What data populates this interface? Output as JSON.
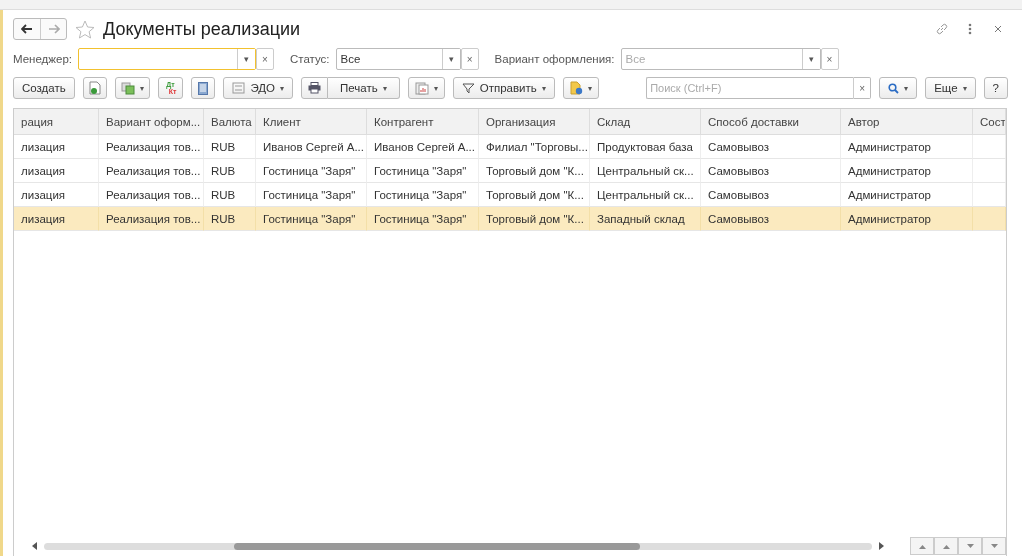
{
  "window": {
    "title": "Документы реализации",
    "favorite": false
  },
  "filters": [
    {
      "label": "Менеджер:",
      "focused": true,
      "dim": false
    },
    {
      "label": "Статус:",
      "value": "Все",
      "focused": false,
      "dim": false
    },
    {
      "label": "Вариант оформления:",
      "value": "Все",
      "focused": false,
      "dim": true
    }
  ],
  "filter_dropdown_glyph": "▾",
  "filter_clear_glyph": "×",
  "toolbar": {
    "create": "Создать",
    "dt_kt": [
      "Дт",
      "Кт"
    ],
    "edo": "ЭДО",
    "print": "Печать",
    "send": "Отправить",
    "search_placeholder": "Поиск (Ctrl+F)",
    "search_clear": "×",
    "more": "Еще",
    "help": "?",
    "caret": "▾"
  },
  "table": {
    "columns": [
      "рация",
      "Вариант оформ...",
      "Валюта",
      "Клиент",
      "Контрагент",
      "Организация",
      "Склад",
      "Способ доставки",
      "Автор",
      "Сост"
    ],
    "rows": [
      {
        "cells": [
          "лизация",
          "Реализация тов...",
          "RUB",
          "Иванов Сергей А...",
          "Иванов Сергей А...",
          "Филиал \"Торговы...",
          "Продуктовая база",
          "Самовывоз",
          "Администратор"
        ],
        "selected": false
      },
      {
        "cells": [
          "лизация",
          "Реализация тов...",
          "RUB",
          "Гостиница \"Заря\"",
          "Гостиница \"Заря\"",
          "Торговый дом \"К...",
          "Центральный ск...",
          "Самовывоз",
          "Администратор"
        ],
        "selected": false
      },
      {
        "cells": [
          "лизация",
          "Реализация тов...",
          "RUB",
          "Гостиница \"Заря\"",
          "Гостиница \"Заря\"",
          "Торговый дом \"К...",
          "Центральный ск...",
          "Самовывоз",
          "Администратор"
        ],
        "selected": false
      },
      {
        "cells": [
          "лизация",
          "Реализация тов...",
          "RUB",
          "Гостиница \"Заря\"",
          "Гостиница \"Заря\"",
          "Торговый дом \"К...",
          "Западный склад",
          "Самовывоз",
          "Администратор"
        ],
        "selected": true
      }
    ]
  }
}
